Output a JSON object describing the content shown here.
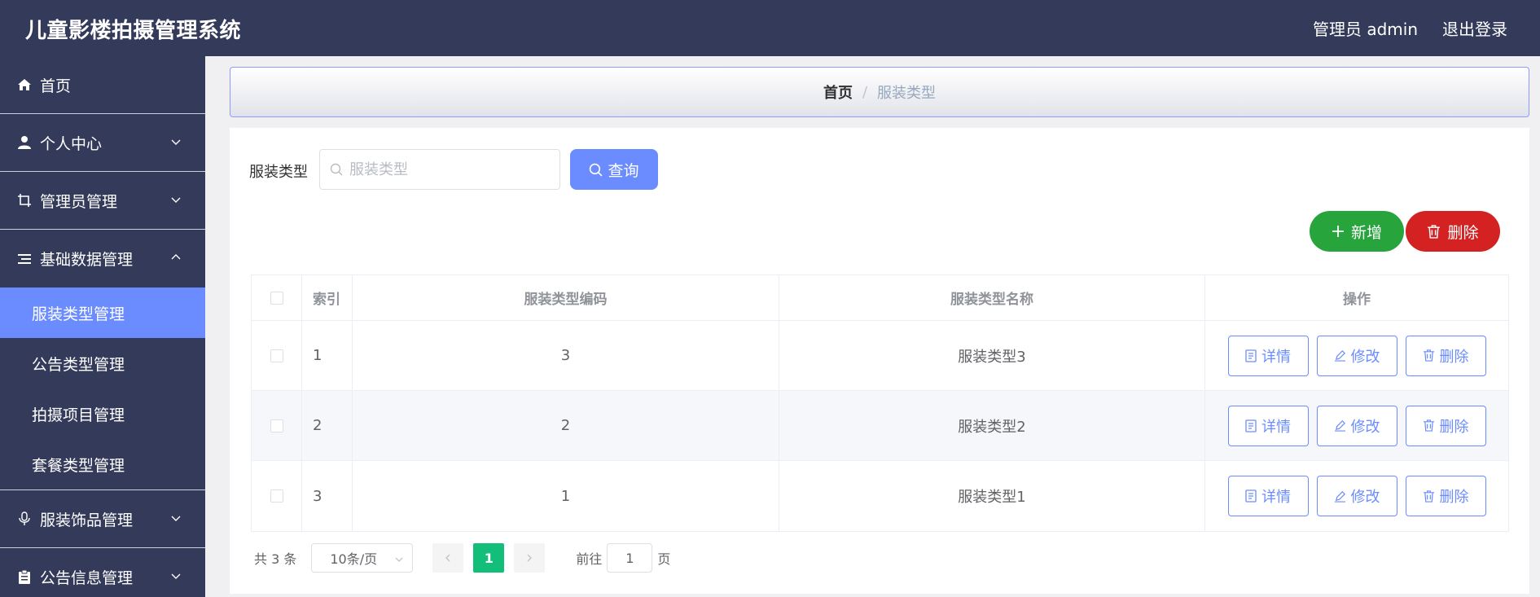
{
  "header": {
    "app_title": "儿童影楼拍摄管理系统",
    "user_label": "管理员 admin",
    "logout_label": "退出登录"
  },
  "sidebar": {
    "items": [
      {
        "label": "首页",
        "icon": "home-icon"
      },
      {
        "label": "个人中心",
        "icon": "user-icon"
      },
      {
        "label": "管理员管理",
        "icon": "crop-icon"
      },
      {
        "label": "基础数据管理",
        "icon": "list-icon"
      },
      {
        "label": "服装饰品管理",
        "icon": "microphone-icon"
      },
      {
        "label": "公告信息管理",
        "icon": "clipboard-icon"
      }
    ],
    "sub_items": [
      {
        "label": "服装类型管理",
        "active": true
      },
      {
        "label": "公告类型管理"
      },
      {
        "label": "拍摄项目管理"
      },
      {
        "label": "套餐类型管理"
      }
    ]
  },
  "breadcrumb": {
    "home": "首页",
    "separator": "/",
    "current": "服装类型"
  },
  "search": {
    "label": "服装类型",
    "placeholder": "服装类型",
    "query_label": "查询"
  },
  "actions": {
    "add_label": "新增",
    "delete_label": "删除"
  },
  "table": {
    "columns": [
      "索引",
      "服装类型编码",
      "服装类型名称",
      "操作"
    ],
    "rows": [
      {
        "index": "1",
        "code": "3",
        "name": "服装类型3"
      },
      {
        "index": "2",
        "code": "2",
        "name": "服装类型2"
      },
      {
        "index": "3",
        "code": "1",
        "name": "服装类型1"
      }
    ],
    "op_labels": {
      "detail": "详情",
      "edit": "修改",
      "delete": "删除"
    }
  },
  "pagination": {
    "total_text": "共 3 条",
    "page_size": "10条/页",
    "current_page": "1",
    "goto_label": "前往",
    "goto_value": "1",
    "page_suffix": "页"
  },
  "colors": {
    "nav_bg": "#343a5a",
    "accent": "#6b8cff",
    "add_green": "#27a43c",
    "delete_red": "#d42222",
    "pager_active": "#13bd7a"
  }
}
